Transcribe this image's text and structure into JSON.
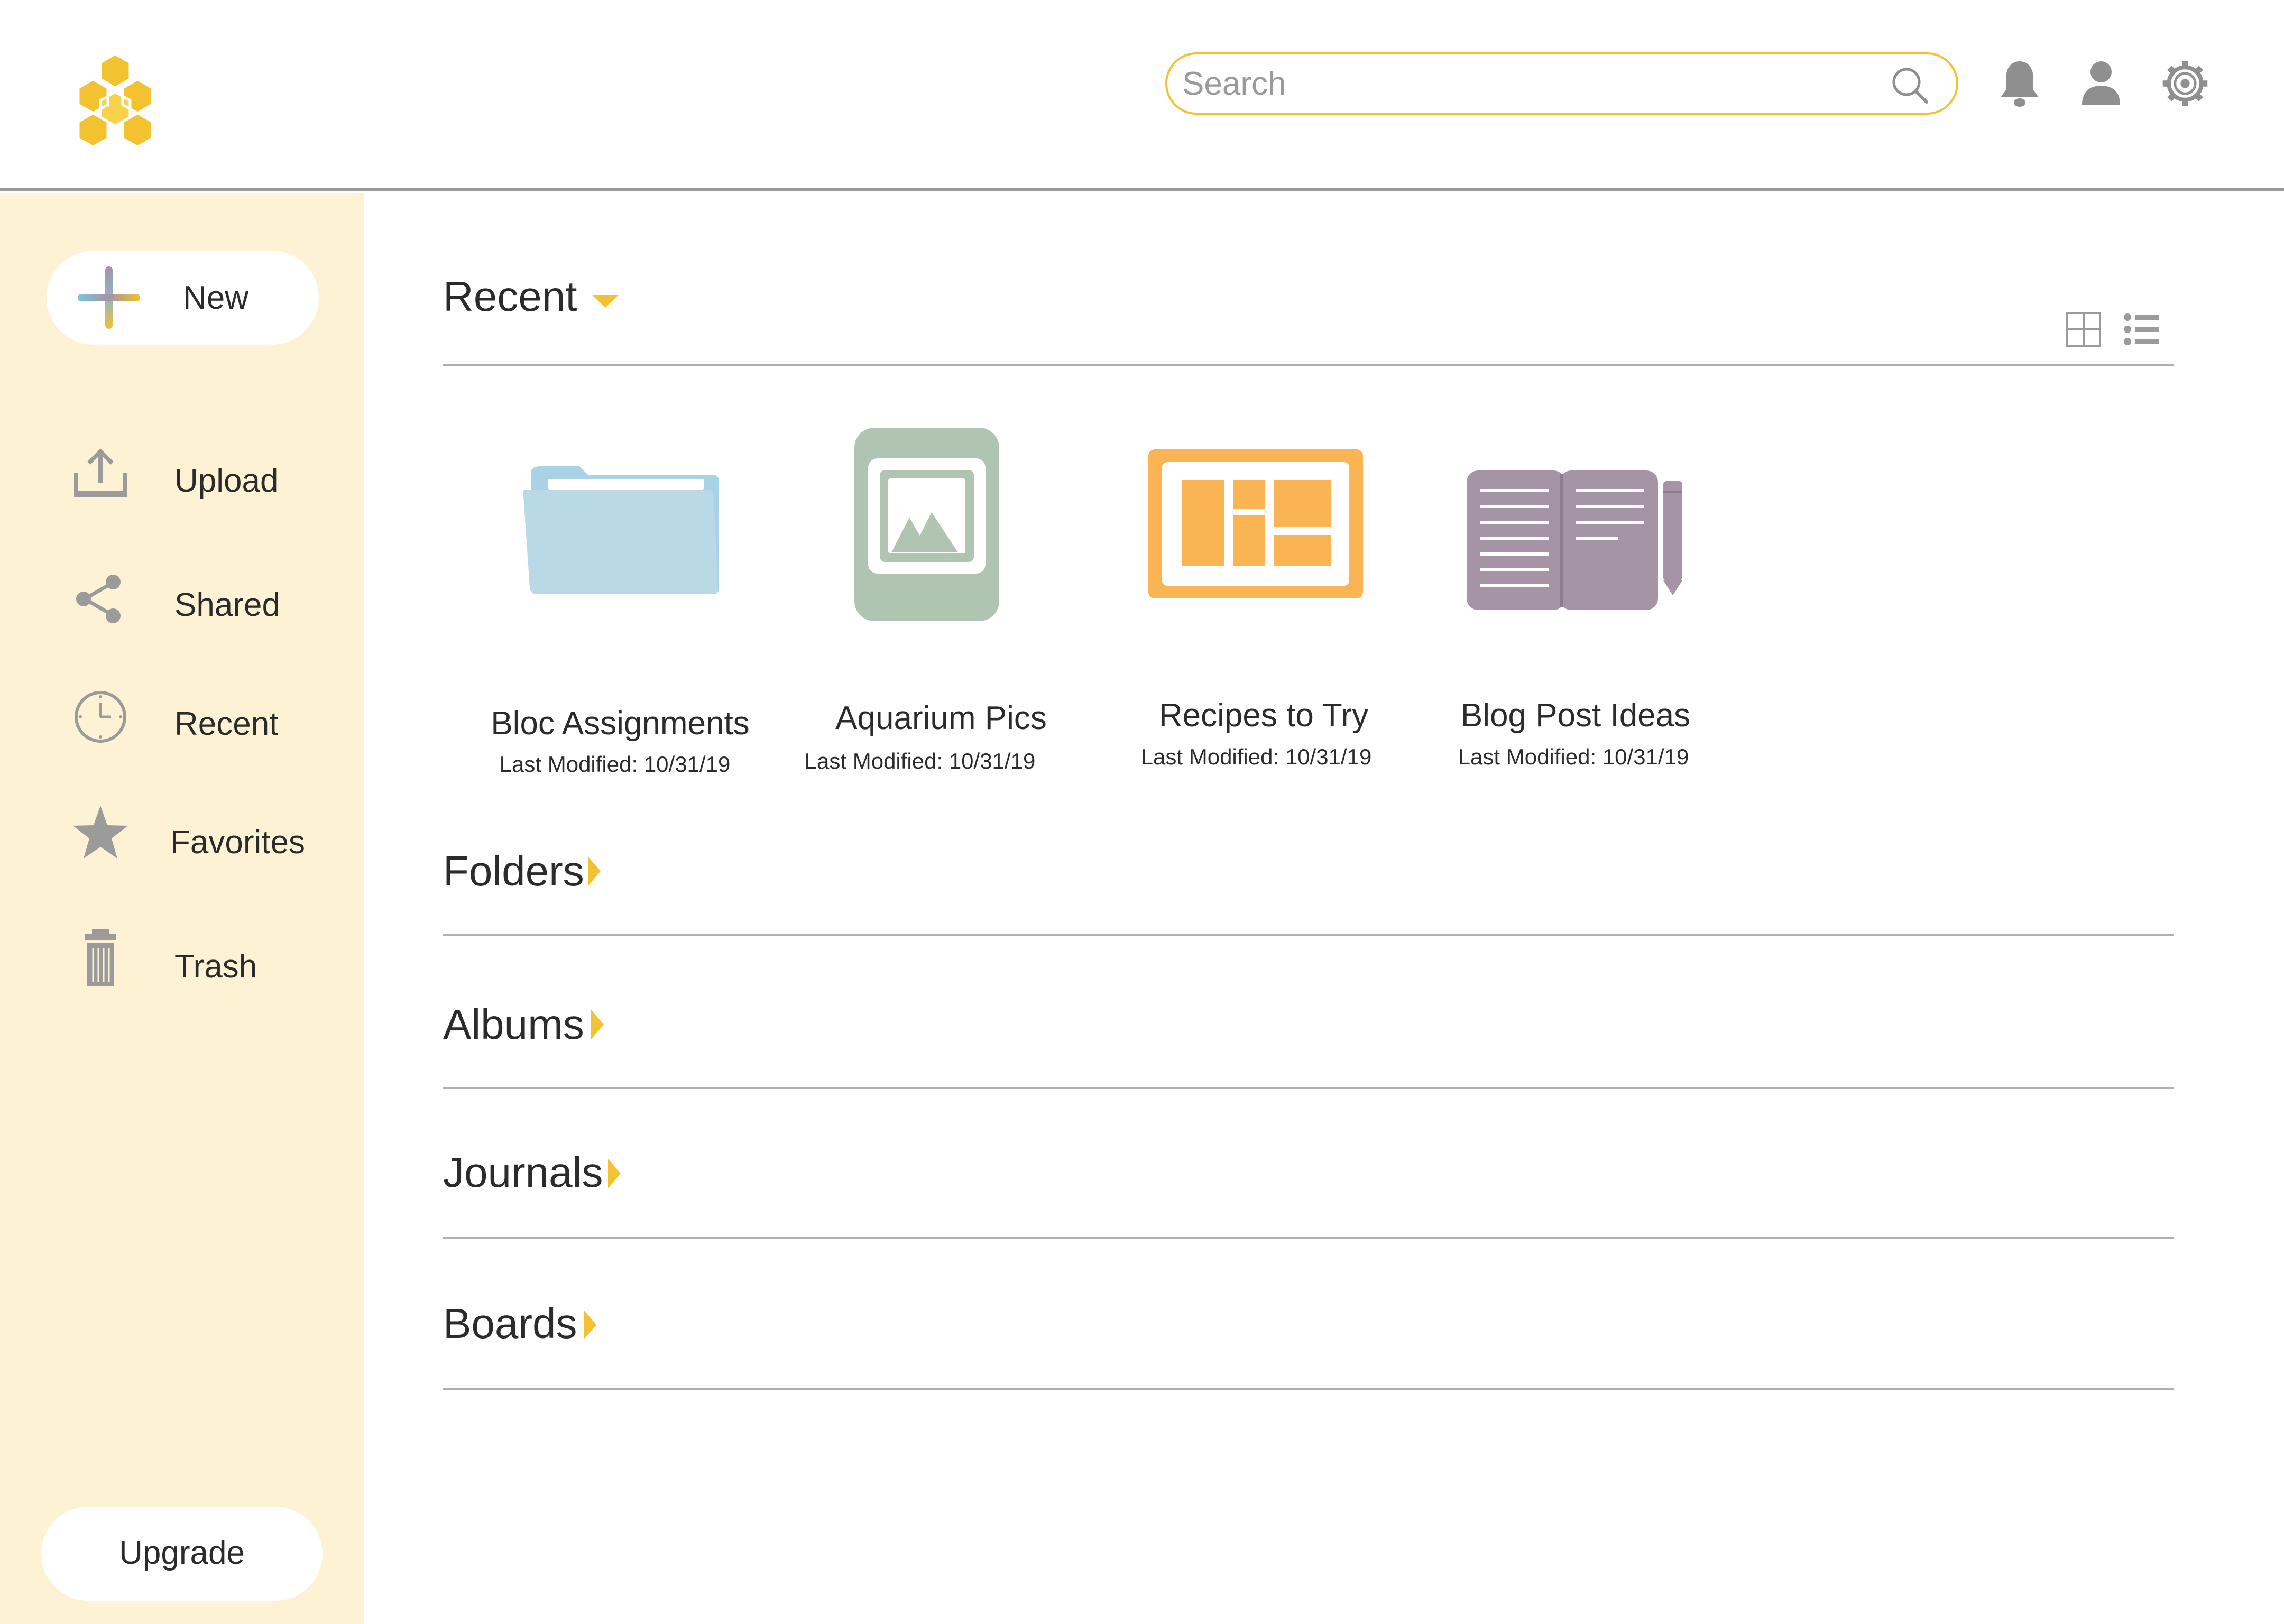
{
  "header": {
    "logo": "honeycomb-logo",
    "search": {
      "placeholder": "Search",
      "value": ""
    },
    "icons": [
      "search-icon",
      "bell-icon",
      "user-icon",
      "gear-icon"
    ]
  },
  "sidebar": {
    "new_label": "New",
    "items": [
      {
        "label": "Upload",
        "icon": "upload-icon"
      },
      {
        "label": "Shared",
        "icon": "share-icon"
      },
      {
        "label": "Recent",
        "icon": "clock-icon"
      },
      {
        "label": "Favorites",
        "icon": "star-icon"
      },
      {
        "label": "Trash",
        "icon": "trash-icon"
      }
    ],
    "upgrade_label": "Upgrade"
  },
  "main": {
    "recent": {
      "title": "Recent",
      "view_icons": [
        "grid-view-icon",
        "list-view-icon"
      ],
      "items": [
        {
          "name": "Bloc Assignments",
          "modified": "Last Modified: 10/31/19",
          "icon": "folder-icon"
        },
        {
          "name": "Aquarium Pics",
          "modified": "Last Modified: 10/31/19",
          "icon": "album-icon"
        },
        {
          "name": "Recipes to Try",
          "modified": "Last Modified: 10/31/19",
          "icon": "board-icon"
        },
        {
          "name": "Blog Post Ideas",
          "modified": "Last Modified: 10/31/19",
          "icon": "journal-icon"
        }
      ]
    },
    "sections": [
      {
        "title": "Folders"
      },
      {
        "title": "Albums"
      },
      {
        "title": "Journals"
      },
      {
        "title": "Boards"
      }
    ]
  },
  "colors": {
    "accent_yellow": "#f2c230",
    "sidebar_bg": "#fdf3d4",
    "folder_blue": "#b9dbe8",
    "album_green": "#afc5b1",
    "board_orange": "#fbb454",
    "journal_purple": "#a593a6",
    "icon_gray": "#9b9b9b"
  }
}
